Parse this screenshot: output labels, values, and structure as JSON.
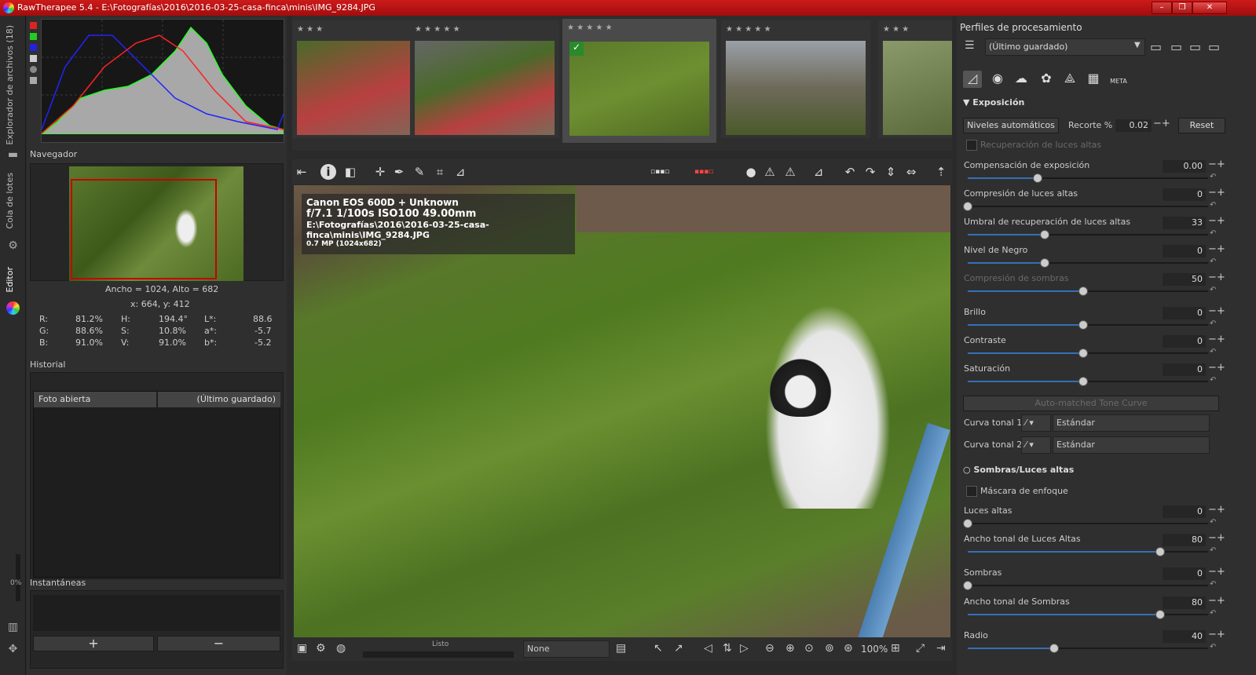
{
  "window": {
    "title": "RawTherapee 5.4 - E:\\Fotografías\\2016\\2016-03-25-casa-finca\\minis\\IMG_9284.JPG",
    "minimize": "–",
    "restore": "❐",
    "close": "✕"
  },
  "vertical_tabs": {
    "file_browser": "Explorador de archivos (18)",
    "batch_queue": "Cola de lotes",
    "editor": "Editor",
    "progress": "0%"
  },
  "navigator": {
    "title": "Navegador",
    "size_line": "Ancho = 1024, Alto = 682",
    "coords": "x: 664, y: 412",
    "values": {
      "r_label": "R:",
      "r": "81.2%",
      "g_label": "G:",
      "g": "88.6%",
      "b_label": "B:",
      "b": "91.0%",
      "h_label": "H:",
      "h": "194.4°",
      "s_label": "S:",
      "s": "10.8%",
      "v_label": "V:",
      "v": "91.0%",
      "l_label": "L*:",
      "l": "88.6",
      "a_label": "a*:",
      "a": "-5.7",
      "bb_label": "b*:",
      "bb": "-5.2"
    }
  },
  "history": {
    "title": "Historial",
    "col1": "Foto abierta",
    "col2": "(Último guardado)"
  },
  "snapshots": {
    "title": "Instantáneas",
    "add": "+",
    "remove": "−"
  },
  "thumbnails": [
    {
      "stars": "★ ★ ★",
      "selected": false
    },
    {
      "stars": "★ ★ ★ ★ ★",
      "selected": false
    },
    {
      "stars": "★ ★ ★ ★ ★",
      "selected": true
    },
    {
      "stars": "★ ★ ★ ★ ★",
      "selected": false
    },
    {
      "stars": "★ ★ ★",
      "selected": false
    }
  ],
  "overlay": {
    "camera": "Canon EOS 600D + Unknown",
    "exposure": "f/7.1  1/100s  ISO100  49.00mm",
    "path": "E:\\Fotografías\\2016\\2016-03-25-casa-finca\\minis\\IMG_9284.JPG",
    "size": "0.7 MP (1024x682)"
  },
  "statusbar": {
    "status": "Listo",
    "combo": "None",
    "zoom": "100%"
  },
  "right": {
    "profiles_title": "Perfiles de procesamiento",
    "profile_value": "(Último guardado)",
    "meta_tab": "META",
    "exposure_title": "Exposición",
    "auto_levels": "Niveles automáticos",
    "clip_label": "Recorte %",
    "clip_value": "0.02",
    "reset": "Reset",
    "highlight_recovery": "Recuperación de luces altas",
    "params": [
      {
        "label": "Compensación de exposición",
        "value": "0.00",
        "frac": 0.29,
        "dim": false
      },
      {
        "label": "Compresión de luces altas",
        "value": "0",
        "frac": 0.0,
        "dim": false
      },
      {
        "label": "Umbral de recuperación de luces altas",
        "value": "33",
        "frac": 0.32,
        "dim": false
      },
      {
        "label": "Nivel de Negro",
        "value": "0",
        "frac": 0.32,
        "dim": false
      },
      {
        "label": "Compresión de sombras",
        "value": "50",
        "frac": 0.48,
        "dim": true
      },
      {
        "label": "Brillo",
        "value": "0",
        "frac": 0.48,
        "dim": false
      },
      {
        "label": "Contraste",
        "value": "0",
        "frac": 0.48,
        "dim": false
      },
      {
        "label": "Saturación",
        "value": "0",
        "frac": 0.48,
        "dim": false
      }
    ],
    "auto_tone": "Auto-matched Tone Curve",
    "curve1_label": "Curva tonal 1:",
    "curve1_value": "Estándar",
    "curve2_label": "Curva tonal 2:",
    "curve2_value": "Estándar",
    "shadows_title": "Sombras/Luces altas",
    "sharp_mask": "Máscara de enfoque",
    "sh_params": [
      {
        "label": "Luces altas",
        "value": "0",
        "frac": 0.0
      },
      {
        "label": "Ancho tonal de Luces Altas",
        "value": "80",
        "frac": 0.8
      },
      {
        "label": "Sombras",
        "value": "0",
        "frac": 0.0
      },
      {
        "label": "Ancho tonal de Sombras",
        "value": "80",
        "frac": 0.8
      },
      {
        "label": "Radio",
        "value": "40",
        "frac": 0.36
      }
    ]
  }
}
